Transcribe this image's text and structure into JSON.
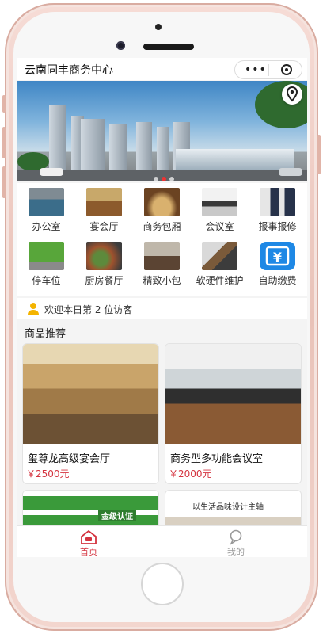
{
  "app": {
    "title": "云南同丰商务中心"
  },
  "capsule": {
    "more_icon": "more-icon",
    "close_icon": "target-icon"
  },
  "banner": {
    "icon": "location-pin-icon",
    "indicator_count": 3,
    "active_index": 1
  },
  "categories": [
    {
      "label": "办公室",
      "icon": "office-photo"
    },
    {
      "label": "宴会厅",
      "icon": "banquet-hall-photo"
    },
    {
      "label": "商务包厢",
      "icon": "private-room-photo"
    },
    {
      "label": "会议室",
      "icon": "meeting-room-photo"
    },
    {
      "label": "报事报修",
      "icon": "customer-service-photo"
    },
    {
      "label": "停车位",
      "icon": "parking-photo"
    },
    {
      "label": "厨房餐厅",
      "icon": "kitchen-photo"
    },
    {
      "label": "精致小包",
      "icon": "small-room-photo"
    },
    {
      "label": "软硬件维护",
      "icon": "hardware-photo"
    },
    {
      "label": "自助缴费",
      "icon": "payment-icon"
    }
  ],
  "visitor": {
    "text": "欢迎本日第 2 位访客"
  },
  "recommend": {
    "title": "商品推荐",
    "items": [
      {
        "name": "玺尊龙高级宴会厅",
        "price": "￥2500元"
      },
      {
        "name": "商务型多功能会议室",
        "price": "￥2000元"
      },
      {
        "name": "",
        "price": "",
        "badge_text": "金级认证"
      },
      {
        "name": "",
        "price": "",
        "banner_text": "以生活品味设计主轴"
      }
    ]
  },
  "tabbar": {
    "tabs": [
      {
        "label": "首页",
        "icon": "home-icon",
        "active": true
      },
      {
        "label": "我的",
        "icon": "user-icon",
        "active": false
      }
    ],
    "active_color": "#d4333f",
    "inactive_color": "#999999"
  }
}
